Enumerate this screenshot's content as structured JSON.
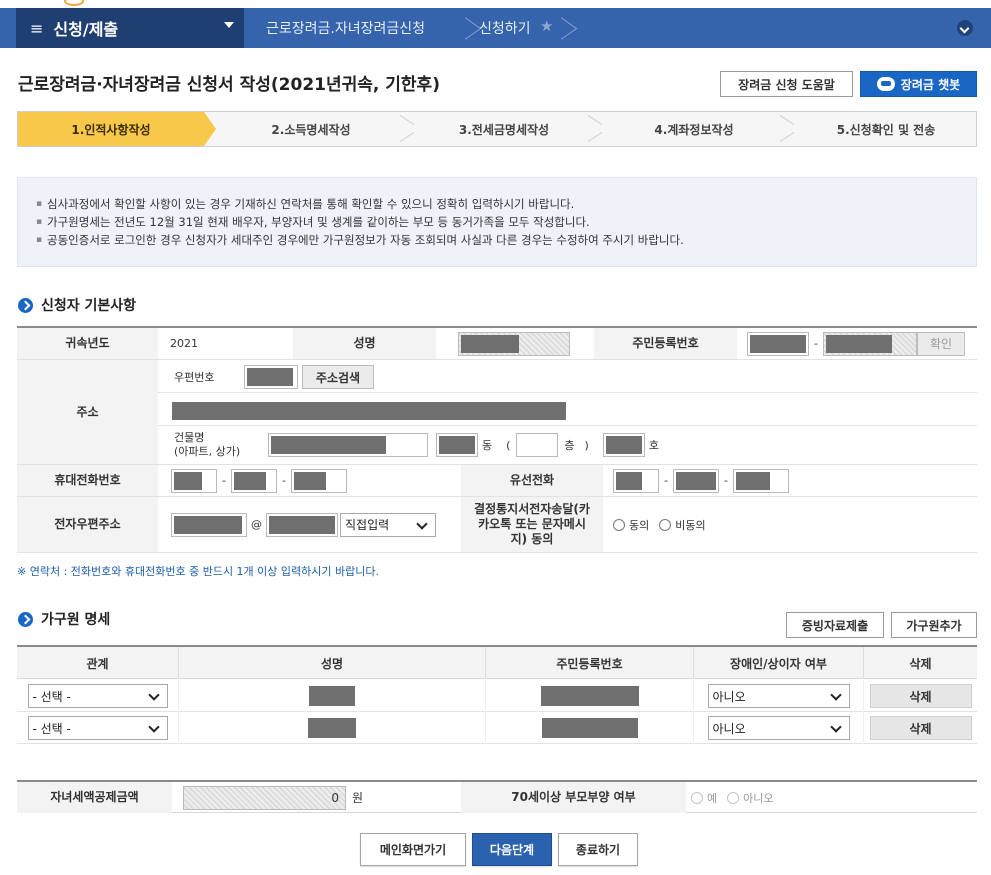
{
  "nav": {
    "menu_title": "신청/제출",
    "crumb1": "근로장려금.자녀장려금신청",
    "crumb2": "신청하기"
  },
  "page": {
    "title": "근로장려금·자녀장려금 신청서 작성(2021년귀속, 기한후)",
    "help_button": "장려금 신청 도움말",
    "chatbot_button": "장려금 챗봇"
  },
  "steps": [
    {
      "label": "1.인적사항작성",
      "active": true
    },
    {
      "label": "2.소득명세작성",
      "active": false
    },
    {
      "label": "3.전세금명세작성",
      "active": false
    },
    {
      "label": "4.계좌정보작성",
      "active": false
    },
    {
      "label": "5.신청확인 및 전송",
      "active": false
    }
  ],
  "notice": [
    "심사과정에서 확인할 사항이 있는 경우 기재하신 연락처를 통해 확인할 수 있으니 정확히 입력하시기 바랍니다.",
    "가구원명세는 전년도 12월 31일 현재 배우자, 부양자녀 및 생계를 같이하는 부모 등 동거가족을 모두 작성합니다.",
    "공동인증서로 로그인한 경우 신청자가 세대주인 경우에만 가구원정보가 자동 조회되며 사실과 다른 경우는 수정하여 주시기 바랍니다."
  ],
  "applicant": {
    "section_title": "신청자 기본사항",
    "year_label": "귀속년도",
    "year_value": "2021",
    "name_label": "성명",
    "rrn_label": "주민등록번호",
    "rrn_dash": "-",
    "confirm_button": "확인",
    "address_label": "주소",
    "zip_label": "우편번호",
    "address_search_button": "주소검색",
    "building_label": "건물명",
    "building_sub": "(아파트, 상가)",
    "dong_label": "동",
    "floor_open": "(",
    "floor_label": "층",
    "floor_close": ")",
    "ho_label": "호",
    "mobile_label": "휴대전화번호",
    "phone_label": "유선전화",
    "dash": "-",
    "email_label": "전자우편주소",
    "email_at": "@",
    "email_domain_select": "직접입력",
    "kakao_label": "결정통지서전자송달(카카오톡 또는 문자메시지) 동의",
    "agree_label": "동의",
    "disagree_label": "비동의",
    "contact_note": "※ 연락처 : 전화번호와 휴대전화번호 중 반드시 1개 이상 입력하시기 바랍니다."
  },
  "family": {
    "section_title": "가구원 명세",
    "proof_button": "증빙자료제출",
    "add_button": "가구원추가",
    "columns": [
      "관계",
      "성명",
      "주민등록번호",
      "장애인/상이자 여부",
      "삭제"
    ],
    "rows": [
      {
        "relation": "- 선택 -",
        "disabled": "아니오",
        "delete": "삭제"
      },
      {
        "relation": "- 선택 -",
        "disabled": "아니오",
        "delete": "삭제"
      }
    ]
  },
  "credit": {
    "label": "자녀세액공제금액",
    "value": "0",
    "unit": "원",
    "parent_label": "70세이상 부모부양 여부",
    "yes": "예",
    "no": "아니오"
  },
  "footer": {
    "main_button": "메인화면가기",
    "next_button": "다음단계",
    "exit_button": "종료하기"
  }
}
